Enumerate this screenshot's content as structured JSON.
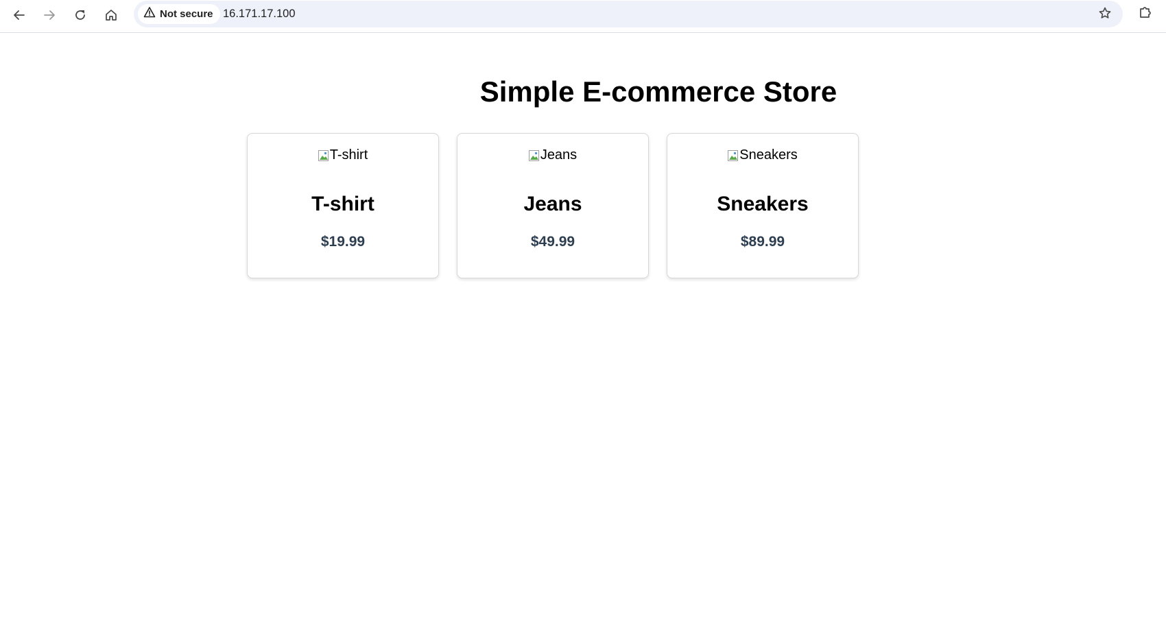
{
  "browser": {
    "security_label": "Not secure",
    "url": "16.171.17.100",
    "icons": {
      "back": "back-arrow-icon",
      "forward": "forward-arrow-icon",
      "reload": "reload-icon",
      "home": "home-icon",
      "security": "warning-triangle-icon",
      "bookmark": "star-icon",
      "extensions": "puzzle-icon"
    }
  },
  "page": {
    "title": "Simple E-commerce Store",
    "products": [
      {
        "image_alt": "T-shirt",
        "name": "T-shirt",
        "price": "$19.99"
      },
      {
        "image_alt": "Jeans",
        "name": "Jeans",
        "price": "$49.99"
      },
      {
        "image_alt": "Sneakers",
        "name": "Sneakers",
        "price": "$89.99"
      }
    ]
  },
  "colors": {
    "price_text": "#2c3e50",
    "omnibox_bg": "#eef1f9"
  }
}
